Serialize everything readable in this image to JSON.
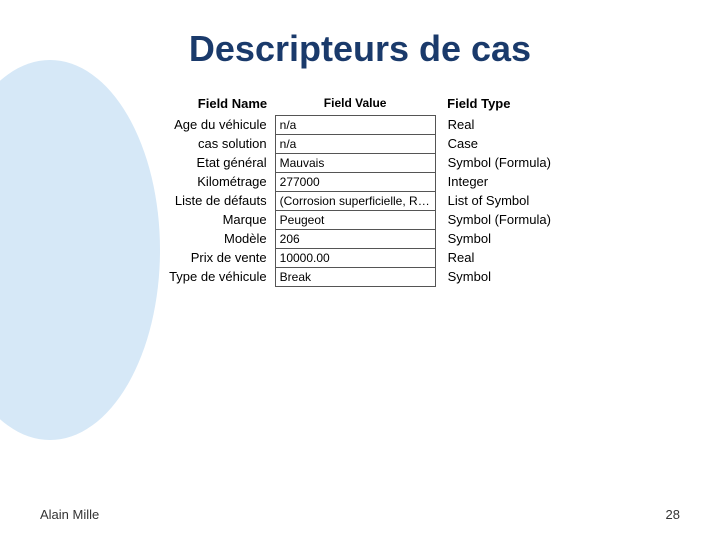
{
  "title": "Descripteurs de cas",
  "table": {
    "headers": {
      "name": "Field Name",
      "value": "Field Value",
      "type": "Field Type"
    },
    "rows": [
      {
        "name": "Age du véhicule",
        "value": "n/a",
        "type": "Real"
      },
      {
        "name": "cas solution",
        "value": "n/a",
        "type": "Case"
      },
      {
        "name": "Etat général",
        "value": "Mauvais",
        "type": "Symbol (Formula)"
      },
      {
        "name": "Kilométrage",
        "value": "277000",
        "type": "Integer"
      },
      {
        "name": "Liste de défauts",
        "value": "(Corrosion superficielle, R…",
        "type": "List of Symbol"
      },
      {
        "name": "Marque",
        "value": "Peugeot",
        "type": "Symbol (Formula)"
      },
      {
        "name": "Modèle",
        "value": "206",
        "type": "Symbol"
      },
      {
        "name": "Prix de vente",
        "value": "10000.00",
        "type": "Real"
      },
      {
        "name": "Type de véhicule",
        "value": "Break",
        "type": "Symbol"
      }
    ]
  },
  "footer": {
    "author": "Alain Mille",
    "page": "28"
  }
}
